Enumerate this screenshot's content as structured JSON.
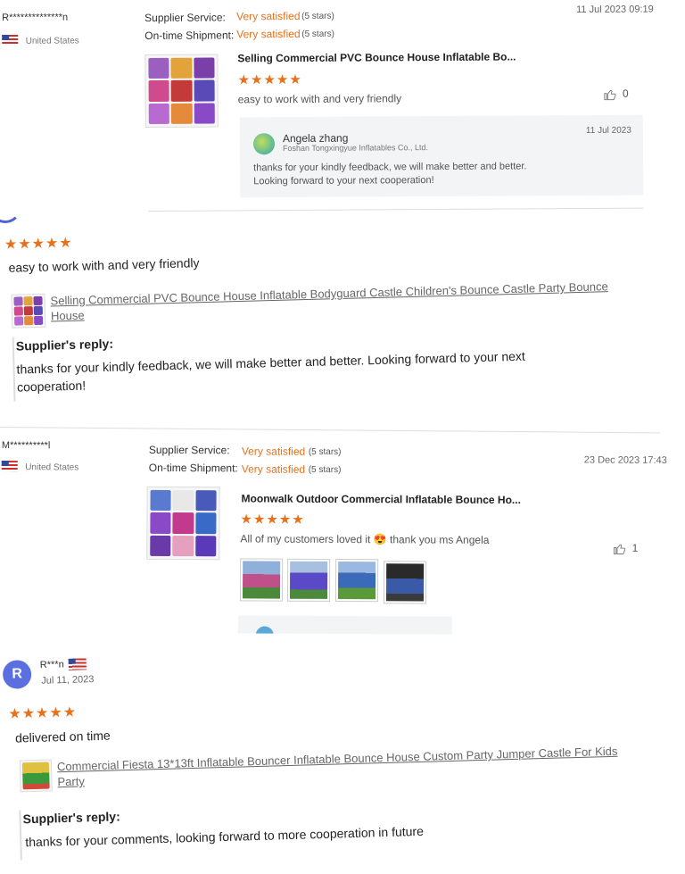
{
  "review1": {
    "reviewer": "R**************n",
    "country": "United States",
    "supplier_service_label": "Supplier Service:",
    "supplier_service_value": "Very satisfied",
    "supplier_service_stars": "(5 stars)",
    "shipment_label": "On-time Shipment:",
    "shipment_value": "Very satisfied",
    "shipment_stars": "(5 stars)",
    "date": "11 Jul 2023 09:19",
    "product_title": "Selling Commercial PVC Bounce House Inflatable Bo...",
    "stars": "★★★★★",
    "comment": "easy to work with and very friendly",
    "likes": "0",
    "reply": {
      "name": "Angela zhang",
      "company": "Foshan Tongxingyue Inflatables Co., Ltd.",
      "date": "11 Jul 2023",
      "line1": "thanks for your kindly feedback, we will make better and better.",
      "line2": "Looking forward to your next cooperation!"
    }
  },
  "review2": {
    "stars": "★★★★★",
    "comment": "easy to work with and very friendly",
    "product_link_line1": "Selling Commercial PVC Bounce House Inflatable Bodyguard Castle Children's Bounce Castle Party Bounce",
    "product_link_line2": "House",
    "reply_title": "Supplier's reply:",
    "reply_line1": "thanks for your kindly feedback, we will make better and better. Looking forward to your next",
    "reply_line2": "cooperation!"
  },
  "review3": {
    "reviewer": "M**********l",
    "country": "United States",
    "supplier_service_label": "Supplier Service:",
    "supplier_service_value": "Very satisfied",
    "supplier_service_stars": "(5 stars)",
    "shipment_label": "On-time Shipment:",
    "shipment_value": "Very satisfied",
    "shipment_stars": "(5 stars)",
    "date": "23 Dec 2023 17:43",
    "product_title": "Moonwalk Outdoor Commercial Inflatable Bounce Ho...",
    "stars": "★★★★★",
    "comment_part1": "All of my customers loved it",
    "emoji": "😍",
    "comment_part2": "thank you ms Angela",
    "likes": "1"
  },
  "review4": {
    "avatar_letter": "R",
    "reviewer": "R***n",
    "date": "Jul 11, 2023",
    "stars": "★★★★★",
    "comment": "delivered on time",
    "product_link_line1": "Commercial Fiesta 13*13ft Inflatable Bouncer Inflatable Bounce House Custom Party Jumper Castle For Kids",
    "product_link_line2": "Party",
    "reply_title": "Supplier's reply:",
    "reply_text": "thanks for your comments, looking forward to more cooperation in future"
  },
  "icons": {
    "like": "thumbs-up-icon",
    "flag": "us-flag-icon"
  }
}
